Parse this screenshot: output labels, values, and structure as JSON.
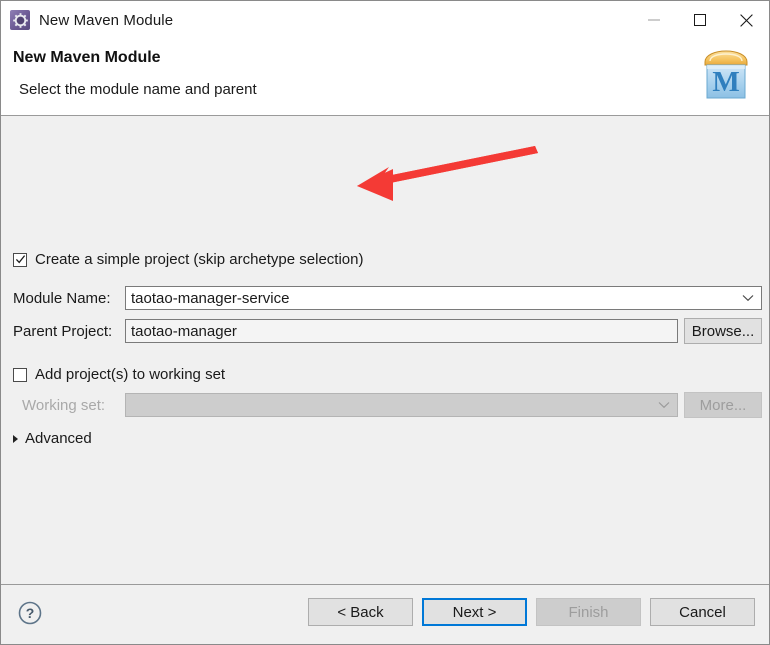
{
  "window": {
    "title": "New Maven Module",
    "icon": "maven-gear-icon",
    "controls": {
      "minimize": "minimize-icon",
      "maximize": "maximize-icon",
      "close": "close-icon"
    }
  },
  "header": {
    "title": "New Maven Module",
    "subtitle": "Select the module name and parent",
    "logo": "maven-box-icon",
    "logo_letter": "M"
  },
  "form": {
    "simple_project": {
      "label": "Create a simple project (skip archetype selection)",
      "checked": true
    },
    "module_name": {
      "label": "Module Name:",
      "value": "taotao-manager-service",
      "placeholder": ""
    },
    "parent_project": {
      "label": "Parent Project:",
      "value": "taotao-manager",
      "placeholder": ""
    },
    "browse_button": "Browse...",
    "add_to_working_set": {
      "label": "Add project(s) to working set",
      "checked": false
    },
    "working_set": {
      "label": "Working set:",
      "value": "",
      "placeholder": ""
    },
    "more_button": "More...",
    "advanced": {
      "label": "Advanced",
      "expanded": false
    }
  },
  "footer": {
    "help": "help-icon",
    "back": "< Back",
    "next": "Next >",
    "finish": "Finish",
    "cancel": "Cancel"
  },
  "annotation": {
    "type": "red-arrow",
    "color": "#f43a35",
    "points_to": "module-name-input"
  },
  "colors": {
    "accent": "#0078d7",
    "dialog_bg": "#f0f0f0",
    "header_bg": "#ffffff",
    "annotation_red": "#f43a35",
    "disabled_text": "#9d9d9d"
  }
}
